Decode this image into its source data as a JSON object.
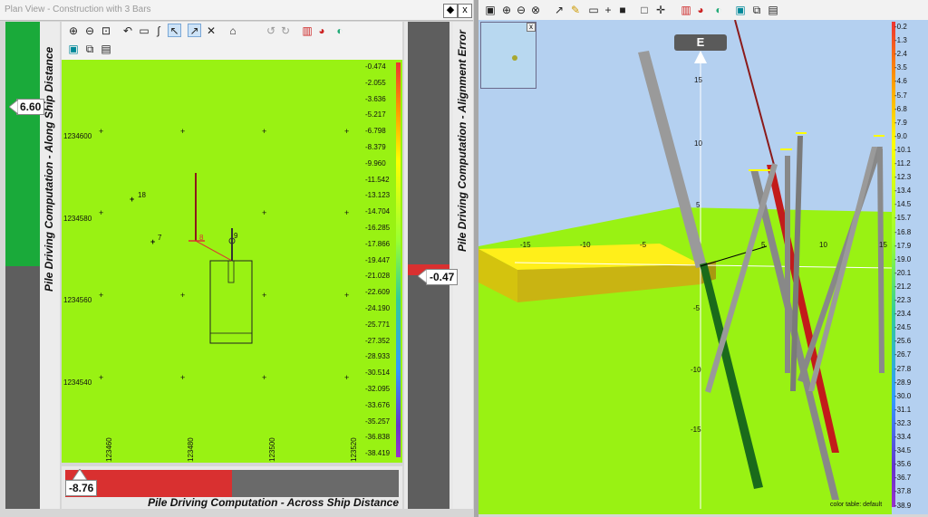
{
  "window": {
    "title": "Plan View - Construction with 3 Bars",
    "pin_icon": "pin-icon",
    "close_label": "x"
  },
  "left_gauge": {
    "label": "Pile Driving Computation - Along Ship Distance",
    "value": "6.60",
    "fill_color": "#1aaa3a",
    "fill_fraction": 0.5
  },
  "right_gauge": {
    "label": "Pile Driving Computation - Alignment Error",
    "value": "-0.47",
    "marker_color": "#d93030"
  },
  "bottom_gauge": {
    "label": "Pile Driving Computation - Across Ship Distance",
    "value": "-8.76",
    "fill_color": "#d93030",
    "fill_fraction": 0.42
  },
  "plan_toolbar": {
    "icons": [
      "zoom-in-icon",
      "zoom-out-icon",
      "zoom-extent-icon",
      "pan-icon",
      "measure-icon",
      "curve-icon",
      "pointer-icon",
      "draw-icon",
      "layers-icon",
      "north-icon",
      "undo-icon",
      "redo-icon",
      "color-scale-icon",
      "palette-icon",
      "theme-icon",
      "fit-icon",
      "copy-icon",
      "save-icon"
    ]
  },
  "plan_view": {
    "y_labels": [
      "1234600",
      "1234580",
      "1234560",
      "1234540"
    ],
    "x_labels": [
      "123460",
      "123480",
      "123500",
      "123520"
    ],
    "point_labels": [
      "18",
      "7",
      "8",
      "9"
    ],
    "colorbar": [
      "-0.474",
      "-2.055",
      "-3.636",
      "-5.217",
      "-6.798",
      "-8.379",
      "-9.960",
      "-11.542",
      "-13.123",
      "-14.704",
      "-16.285",
      "-17.866",
      "-19.447",
      "-21.028",
      "-22.609",
      "-24.190",
      "-25.771",
      "-27.352",
      "-28.933",
      "-30.514",
      "-32.095",
      "-33.676",
      "-35.257",
      "-36.838",
      "-38.419"
    ]
  },
  "view3d": {
    "toolbar_icons": [
      "fit-icon",
      "zoom-in-icon",
      "zoom-out-icon",
      "zoom-window-icon",
      "draw-icon",
      "light-icon",
      "measure-icon",
      "cross-icon",
      "camera-icon",
      "box-icon",
      "move-icon",
      "color-scale-icon",
      "palette-icon",
      "theme-icon",
      "fit-icon",
      "copy-icon",
      "save-icon"
    ],
    "compass": "E",
    "vertical_ticks": [
      "15",
      "10",
      "5",
      "-5",
      "-10",
      "-15"
    ],
    "horizontal_ticks": [
      "-15",
      "-10",
      "-5",
      "5",
      "10",
      "15"
    ],
    "color_table_label": "color table: default",
    "colorbar": [
      "-0.2",
      "-1.3",
      "-2.4",
      "-3.5",
      "-4.6",
      "-5.7",
      "-6.8",
      "-7.9",
      "-9.0",
      "-10.1",
      "-11.2",
      "-12.3",
      "-13.4",
      "-14.5",
      "-15.7",
      "-16.8",
      "-17.9",
      "-19.0",
      "-20.1",
      "-21.2",
      "-22.3",
      "-23.4",
      "-24.5",
      "-25.6",
      "-26.7",
      "-27.8",
      "-28.9",
      "-30.0",
      "-31.1",
      "-32.3",
      "-33.4",
      "-34.5",
      "-35.6",
      "-36.7",
      "-37.8",
      "-38.9"
    ]
  }
}
